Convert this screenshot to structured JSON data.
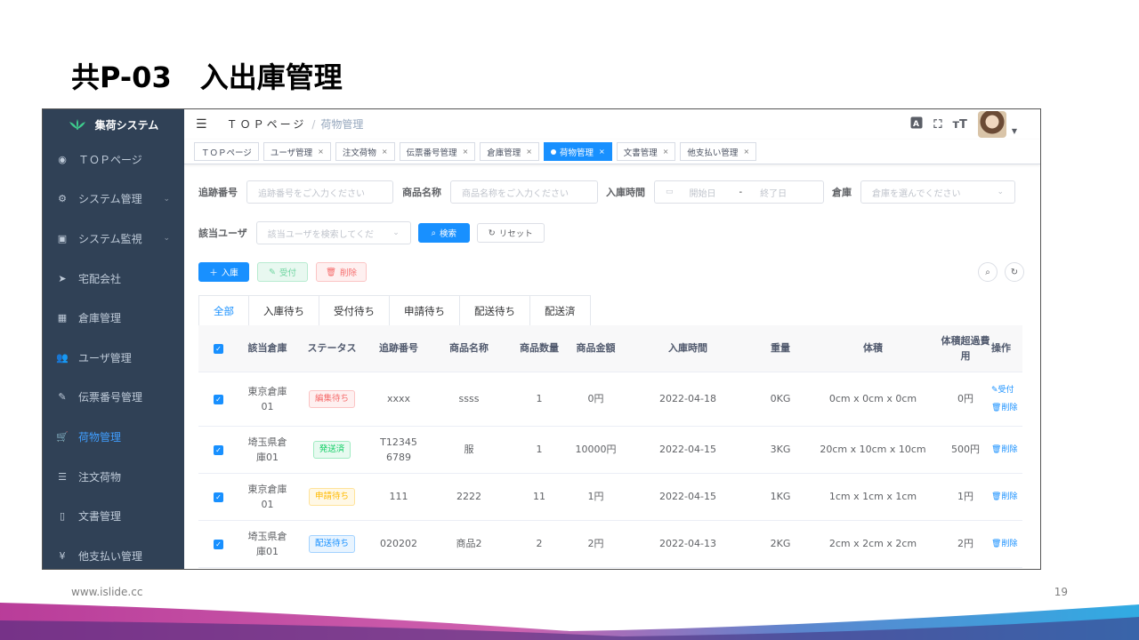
{
  "slide": {
    "title": "共P-03　入出庫管理",
    "footer_url": "www.islide.cc",
    "page_number": "19"
  },
  "sidebar": {
    "app_name": "集荷システム",
    "items": [
      {
        "label": "ＴＯＰページ",
        "icon": "dashboard-icon",
        "has_arrow": false,
        "active": false
      },
      {
        "label": "システム管理",
        "icon": "gear-icon",
        "has_arrow": true,
        "active": false
      },
      {
        "label": "システム監視",
        "icon": "monitor-icon",
        "has_arrow": true,
        "active": false
      },
      {
        "label": "宅配会社",
        "icon": "send-icon",
        "has_arrow": false,
        "active": false
      },
      {
        "label": "倉庫管理",
        "icon": "grid-icon",
        "has_arrow": false,
        "active": false
      },
      {
        "label": "ユーザ管理",
        "icon": "users-icon",
        "has_arrow": false,
        "active": false
      },
      {
        "label": "伝票番号管理",
        "icon": "edit-icon",
        "has_arrow": false,
        "active": false
      },
      {
        "label": "荷物管理",
        "icon": "cart-icon",
        "has_arrow": false,
        "active": true
      },
      {
        "label": "注文荷物",
        "icon": "list-icon",
        "has_arrow": false,
        "active": false
      },
      {
        "label": "文書管理",
        "icon": "book-icon",
        "has_arrow": false,
        "active": false
      },
      {
        "label": "他支払い管理",
        "icon": "yen-icon",
        "has_arrow": false,
        "active": false
      }
    ],
    "active_color": "#409eff",
    "bg_color": "#304156"
  },
  "navbar": {
    "breadcrumb_root": "ＴＯＰページ",
    "breadcrumb_sep": "/",
    "breadcrumb_current": "荷物管理"
  },
  "tags": [
    {
      "label": "ＴＯＰページ",
      "closable": false,
      "active": false
    },
    {
      "label": "ユーザ管理",
      "closable": true,
      "active": false
    },
    {
      "label": "注文荷物",
      "closable": true,
      "active": false
    },
    {
      "label": "伝票番号管理",
      "closable": true,
      "active": false
    },
    {
      "label": "倉庫管理",
      "closable": true,
      "active": false
    },
    {
      "label": "荷物管理",
      "closable": true,
      "active": true
    },
    {
      "label": "文書管理",
      "closable": true,
      "active": false
    },
    {
      "label": "他支払い管理",
      "closable": true,
      "active": false
    }
  ],
  "search": {
    "tracking_label": "追跡番号",
    "tracking_placeholder": "追跡番号をご入力ください",
    "product_label": "商品名称",
    "product_placeholder": "商品名称をご入力ください",
    "time_label": "入庫時間",
    "start_placeholder": "開始日",
    "range_sep": "-",
    "end_placeholder": "終了日",
    "warehouse_label": "倉庫",
    "warehouse_placeholder": "倉庫を選んでください",
    "user_label": "該当ユーザ",
    "user_placeholder": "該当ユーザを検索してくだ",
    "search_button": "検索",
    "reset_button": "リセット"
  },
  "actions": {
    "add_button": "入庫",
    "receive_button": "受付",
    "delete_button": "削除"
  },
  "tabs": [
    "全部",
    "入庫待ち",
    "受付待ち",
    "申請待ち",
    "配送待ち",
    "配送済"
  ],
  "active_tab": 0,
  "table": {
    "columns": [
      "該当倉庫",
      "ステータス",
      "追跡番号",
      "商品名称",
      "商品数量",
      "商品金額",
      "入庫時間",
      "重量",
      "体積",
      "体積超過費用",
      "操作"
    ],
    "rows": [
      {
        "warehouse": "東京倉庫01",
        "status": "編集待ち",
        "status_color": "#f56c6c",
        "tracking": "xxxx",
        "product": "ssss",
        "qty": "1",
        "amount": "0円",
        "time": "2022-04-18",
        "weight": "0KG",
        "volume": "0cm x 0cm x 0cm",
        "fee": "0円",
        "ops": [
          "受付",
          "削除"
        ]
      },
      {
        "warehouse": "埼玉県倉庫01",
        "status": "発送済",
        "status_color": "#13ce66",
        "tracking": "T123456789",
        "product": "服",
        "qty": "1",
        "amount": "10000円",
        "time": "2022-04-15",
        "weight": "3KG",
        "volume": "20cm x 10cm x 10cm",
        "fee": "500円",
        "ops": [
          "削除"
        ]
      },
      {
        "warehouse": "東京倉庫01",
        "status": "申請待ち",
        "status_color": "#ffba00",
        "tracking": "111",
        "product": "2222",
        "qty": "11",
        "amount": "1円",
        "time": "2022-04-15",
        "weight": "1KG",
        "volume": "1cm x 1cm x 1cm",
        "fee": "1円",
        "ops": [
          "削除"
        ]
      },
      {
        "warehouse": "埼玉県倉庫01",
        "status": "配送待ち",
        "status_color": "#1890ff",
        "tracking": "020202",
        "product": "商品2",
        "qty": "2",
        "amount": "2円",
        "time": "2022-04-13",
        "weight": "2KG",
        "volume": "2cm x 2cm x 2cm",
        "fee": "2円",
        "ops": [
          "削除"
        ]
      }
    ]
  }
}
